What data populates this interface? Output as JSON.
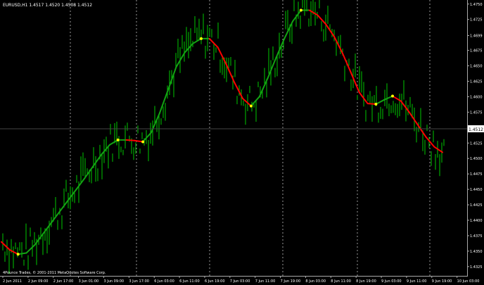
{
  "chart": {
    "symbol_line": "EURUSD,H1  1.4517 1.4520 1.4508 1.4512",
    "copyright": "4Pounce Trades, © 2001-2011 MetaQuotes Software Corp.",
    "current_price": "1.4512",
    "colors": {
      "background": "#000000",
      "candles": "#00c800",
      "ma_up": "#13a313",
      "ma_down": "#ff0000",
      "ma_turn": "#ffff00",
      "grid": "#ffffff",
      "axis_text": "#ffffff"
    }
  },
  "chart_data": {
    "type": "line",
    "title": "EURUSD,H1",
    "xlabel": "",
    "ylabel": "",
    "ylim": [
      1.431,
      1.4752
    ],
    "y_ticks": [
      "1.4750",
      "1.4725",
      "1.4699",
      "1.4675",
      "1.4650",
      "1.4625",
      "1.4600",
      "1.4575",
      "1.4550",
      "1.4525",
      "1.4500",
      "1.4475",
      "1.4450",
      "1.4425",
      "1.4400",
      "1.4375",
      "1.4350",
      "1.4325"
    ],
    "x_ticks": [
      "2 Jun 2011",
      "2 Jun 09:00",
      "2 Jun 17:00",
      "3 Jun 01:00",
      "3 Jun 09:00",
      "3 Jun 17:00",
      "6 Jun 03:00",
      "6 Jun 11:00",
      "6 Jun 19:00",
      "7 Jun 03:00",
      "7 Jun 11:00",
      "7 Jun 19:00",
      "8 Jun 03:00",
      "8 Jun 11:00",
      "8 Jun 19:00",
      "9 Jun 03:00",
      "9 Jun 11:00",
      "9 Jun 19:00",
      "10 Jun 03:00"
    ],
    "series": [
      {
        "values": [
          1.4365,
          1.4352,
          1.4345,
          1.4347,
          1.436,
          1.4378,
          1.4396,
          1.4414,
          1.4432,
          1.445,
          1.4468,
          1.4487,
          1.4506,
          1.4522,
          1.453,
          1.453,
          1.4529,
          1.4527,
          1.4542,
          1.4573,
          1.461,
          1.4648,
          1.4671,
          1.4686,
          1.4694,
          1.4694,
          1.468,
          1.4653,
          1.4623,
          1.4597,
          1.4585,
          1.46,
          1.463,
          1.4663,
          1.4694,
          1.4722,
          1.474,
          1.474,
          1.4732,
          1.4717,
          1.4697,
          1.467,
          1.4639,
          1.4607,
          1.4589,
          1.4588,
          1.4595,
          1.4601,
          1.4593,
          1.4575,
          1.4555,
          1.4535,
          1.4519,
          1.451
        ]
      }
    ]
  }
}
